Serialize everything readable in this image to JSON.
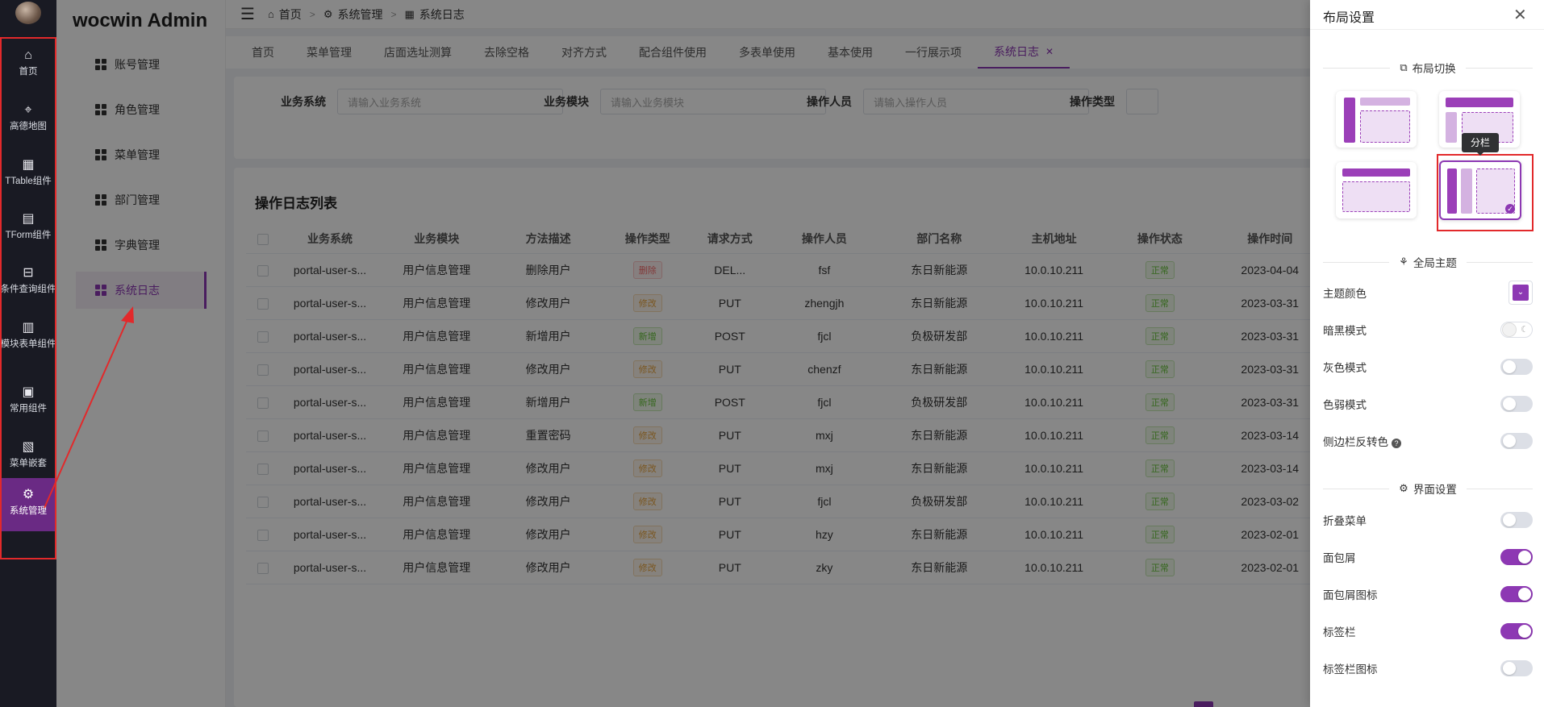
{
  "rail": {
    "items": [
      {
        "label": "首页",
        "icon": "home-icon"
      },
      {
        "label": "高德地图",
        "icon": "map-pin-icon"
      },
      {
        "label": "TTable组件",
        "icon": "grid-icon"
      },
      {
        "label": "TForm组件",
        "icon": "form-icon"
      },
      {
        "label": "条件查询组件",
        "icon": "inbox-icon"
      },
      {
        "label": "模块表单组件",
        "icon": "document-icon"
      },
      {
        "label": "常用组件",
        "icon": "briefcase-icon"
      },
      {
        "label": "菜单嵌套",
        "icon": "clipboard-icon"
      },
      {
        "label": "系统管理",
        "icon": "gear-icon"
      }
    ]
  },
  "submenu": {
    "brand": "wocwin Admin",
    "items": [
      "账号管理",
      "角色管理",
      "菜单管理",
      "部门管理",
      "字典管理",
      "系统日志"
    ],
    "active_index": 5
  },
  "header": {
    "breadcrumbs": [
      "首页",
      "系统管理",
      "系统日志"
    ]
  },
  "tabs": [
    "首页",
    "菜单管理",
    "店面选址测算",
    "去除空格",
    "对齐方式",
    "配合组件使用",
    "多表单使用",
    "基本使用",
    "一行展示项",
    "系统日志"
  ],
  "active_tab": "系统日志",
  "search": {
    "fields": [
      {
        "label": "业务系统",
        "placeholder": "请输入业务系统"
      },
      {
        "label": "业务模块",
        "placeholder": "请输入业务模块"
      },
      {
        "label": "操作人员",
        "placeholder": "请输入操作人员"
      },
      {
        "label": "操作类型",
        "placeholder": ""
      }
    ]
  },
  "table": {
    "title": "操作日志列表",
    "columns": [
      "业务系统",
      "业务模块",
      "方法描述",
      "操作类型",
      "请求方式",
      "操作人员",
      "部门名称",
      "主机地址",
      "操作状态",
      "操作时间"
    ],
    "rows": [
      [
        "portal-user-s...",
        "用户信息管理",
        "删除用户",
        "删除",
        "DEL...",
        "fsf",
        "东日新能源",
        "10.0.10.211",
        "正常",
        "2023-04-04"
      ],
      [
        "portal-user-s...",
        "用户信息管理",
        "修改用户",
        "修改",
        "PUT",
        "zhengjh",
        "东日新能源",
        "10.0.10.211",
        "正常",
        "2023-03-31"
      ],
      [
        "portal-user-s...",
        "用户信息管理",
        "新增用户",
        "新增",
        "POST",
        "fjcl",
        "负极研发部",
        "10.0.10.211",
        "正常",
        "2023-03-31"
      ],
      [
        "portal-user-s...",
        "用户信息管理",
        "修改用户",
        "修改",
        "PUT",
        "chenzf",
        "东日新能源",
        "10.0.10.211",
        "正常",
        "2023-03-31"
      ],
      [
        "portal-user-s...",
        "用户信息管理",
        "新增用户",
        "新增",
        "POST",
        "fjcl",
        "负极研发部",
        "10.0.10.211",
        "正常",
        "2023-03-31"
      ],
      [
        "portal-user-s...",
        "用户信息管理",
        "重置密码",
        "修改",
        "PUT",
        "mxj",
        "东日新能源",
        "10.0.10.211",
        "正常",
        "2023-03-14"
      ],
      [
        "portal-user-s...",
        "用户信息管理",
        "修改用户",
        "修改",
        "PUT",
        "mxj",
        "东日新能源",
        "10.0.10.211",
        "正常",
        "2023-03-14"
      ],
      [
        "portal-user-s...",
        "用户信息管理",
        "修改用户",
        "修改",
        "PUT",
        "fjcl",
        "负极研发部",
        "10.0.10.211",
        "正常",
        "2023-03-02"
      ],
      [
        "portal-user-s...",
        "用户信息管理",
        "修改用户",
        "修改",
        "PUT",
        "hzy",
        "东日新能源",
        "10.0.10.211",
        "正常",
        "2023-02-01"
      ],
      [
        "portal-user-s...",
        "用户信息管理",
        "修改用户",
        "修改",
        "PUT",
        "zky",
        "东日新能源",
        "10.0.10.211",
        "正常",
        "2023-02-01"
      ]
    ]
  },
  "drawer": {
    "title": "布局设置",
    "layout_section": "布局切换",
    "tooltip": "分栏",
    "theme_section": "全局主题",
    "interface_section": "界面设置",
    "theme_color_label": "主题颜色",
    "theme_color": "#8d38b3",
    "toggles": [
      {
        "label": "暗黑模式",
        "on": false,
        "type": "dark"
      },
      {
        "label": "灰色模式",
        "on": false
      },
      {
        "label": "色弱模式",
        "on": false
      },
      {
        "label": "侧边栏反转色",
        "on": false,
        "help": true
      },
      {
        "label": "折叠菜单",
        "on": false
      },
      {
        "label": "面包屑",
        "on": true
      },
      {
        "label": "面包屑图标",
        "on": true
      },
      {
        "label": "标签栏",
        "on": true
      },
      {
        "label": "标签栏图标",
        "on": false
      }
    ]
  }
}
